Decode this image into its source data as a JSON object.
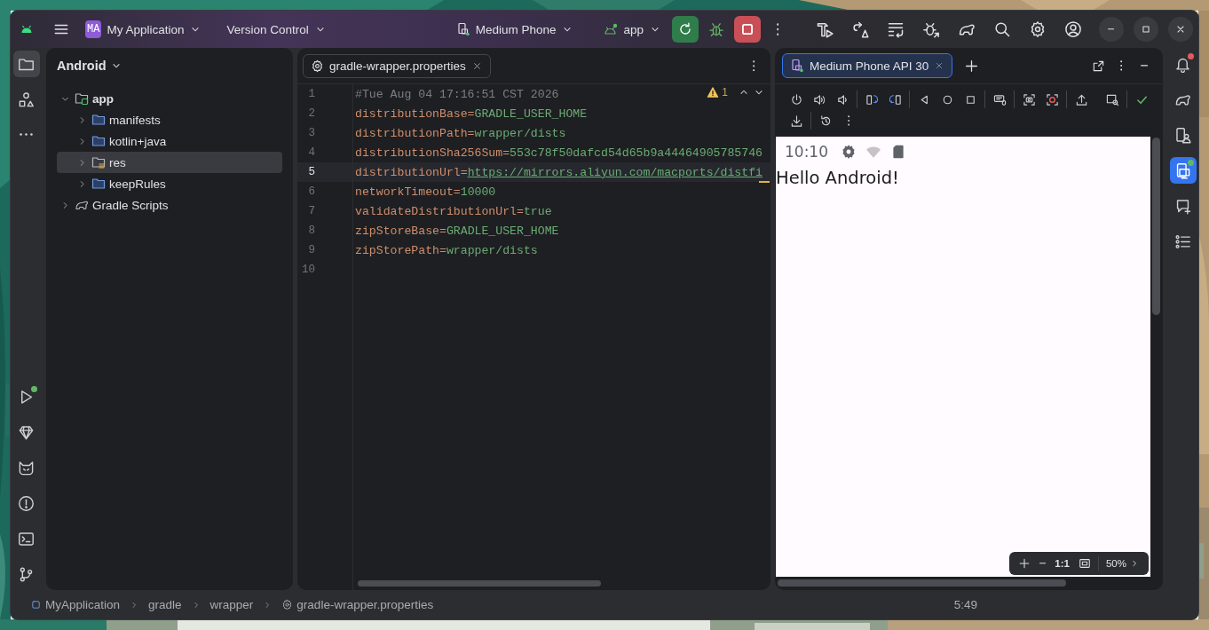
{
  "title_bar": {
    "badge": "MA",
    "project": "My Application",
    "vcs": "Version Control",
    "device": "Medium Phone",
    "run_config": "app"
  },
  "left_tools": [
    {
      "kind": "project",
      "selected": true
    },
    {
      "kind": "resources",
      "selected": false
    },
    {
      "kind": "more",
      "selected": false
    }
  ],
  "left_tools_bottom": [
    {
      "kind": "run",
      "selected": false,
      "color": "#5fb865"
    },
    {
      "kind": "variants",
      "selected": false
    },
    {
      "kind": "logcat",
      "selected": false
    },
    {
      "kind": "problems",
      "selected": false
    },
    {
      "kind": "terminal",
      "selected": false
    },
    {
      "kind": "vcs",
      "selected": false
    }
  ],
  "right_tools": [
    {
      "kind": "notifications",
      "selected": false,
      "color": "#e55b5b"
    },
    {
      "kind": "gradle",
      "selected": false
    },
    {
      "kind": "device_manager",
      "selected": false
    },
    {
      "kind": "running_devices",
      "selected": true,
      "color": "#5fb865"
    },
    {
      "kind": "app_quality",
      "selected": false
    },
    {
      "kind": "structure",
      "selected": false
    }
  ],
  "project_panel": {
    "view": "Android",
    "tree": [
      {
        "label": "app",
        "kind": "module",
        "expanded": true,
        "selected": false,
        "children": [
          {
            "label": "manifests",
            "kind": "folder",
            "expanded": false,
            "selected": false
          },
          {
            "label": "kotlin+java",
            "kind": "folder",
            "expanded": false,
            "selected": false
          },
          {
            "label": "res",
            "kind": "res",
            "expanded": false,
            "selected": true
          },
          {
            "label": "keepRules",
            "kind": "folder",
            "expanded": false,
            "selected": false
          }
        ]
      },
      {
        "label": "Gradle Scripts",
        "kind": "gradle",
        "expanded": false,
        "selected": false
      }
    ]
  },
  "editor": {
    "tab": "gradle-wrapper.properties",
    "warnings": "1",
    "lines": [
      {
        "number": "1",
        "current": false,
        "parts": [
          {
            "kind": "comment",
            "text": "#Tue Aug 04 17:16:51 CST 2026"
          }
        ]
      },
      {
        "number": "2",
        "current": false,
        "parts": [
          {
            "kind": "key",
            "text": "distributionBase="
          },
          {
            "kind": "value",
            "text": "GRADLE_USER_HOME"
          }
        ]
      },
      {
        "number": "3",
        "current": false,
        "parts": [
          {
            "kind": "key",
            "text": "distributionPath="
          },
          {
            "kind": "value",
            "text": "wrapper/dists"
          }
        ]
      },
      {
        "number": "4",
        "current": false,
        "parts": [
          {
            "kind": "key",
            "text": "distributionSha256Sum="
          },
          {
            "kind": "value",
            "text": "553c78f50dafcd54d65b9a44464905785746"
          }
        ]
      },
      {
        "number": "5",
        "current": true,
        "parts": [
          {
            "kind": "key",
            "text": "distributionUrl="
          },
          {
            "kind": "link",
            "text": "https://mirrors.aliyun.com/macports/distfi"
          }
        ]
      },
      {
        "number": "6",
        "current": false,
        "parts": [
          {
            "kind": "key",
            "text": "networkTimeout="
          },
          {
            "kind": "value",
            "text": "10000"
          }
        ]
      },
      {
        "number": "7",
        "current": false,
        "parts": [
          {
            "kind": "key",
            "text": "validateDistributionUrl="
          },
          {
            "kind": "value",
            "text": "true"
          }
        ]
      },
      {
        "number": "8",
        "current": false,
        "parts": [
          {
            "kind": "key",
            "text": "zipStoreBase="
          },
          {
            "kind": "value",
            "text": "GRADLE_USER_HOME"
          }
        ]
      },
      {
        "number": "9",
        "current": false,
        "parts": [
          {
            "kind": "key",
            "text": "zipStorePath="
          },
          {
            "kind": "value",
            "text": "wrapper/dists"
          }
        ]
      },
      {
        "number": "10",
        "current": false
      }
    ]
  },
  "device_panel": {
    "tab": "Medium Phone API 30",
    "screen": {
      "time": "10:10",
      "text": "Hello Android!"
    },
    "zoom": {
      "actual_size": "1:1",
      "percent": "50%"
    }
  },
  "status_bar": {
    "breadcrumbs": [
      {
        "kind": "module",
        "label": "MyApplication"
      },
      {
        "kind": "folder",
        "label": "gradle"
      },
      {
        "kind": "folder",
        "label": "wrapper"
      },
      {
        "kind": "file",
        "label": "gradle-wrapper.properties"
      }
    ],
    "position": "5:49"
  }
}
